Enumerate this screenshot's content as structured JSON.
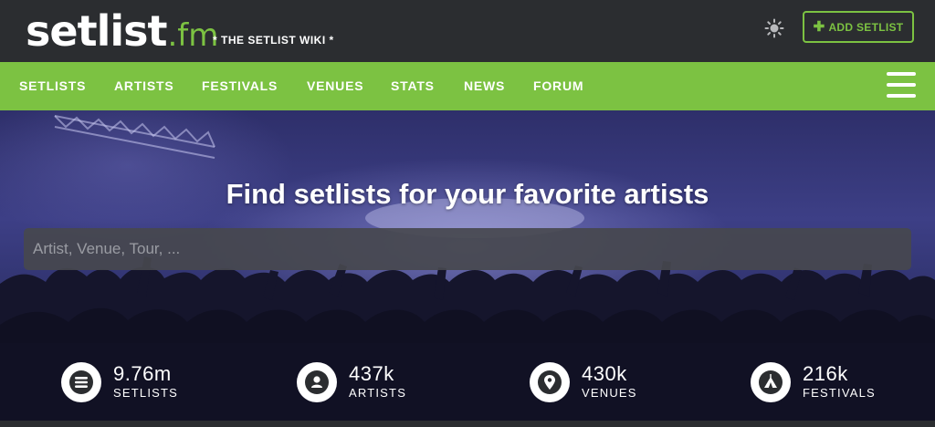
{
  "header": {
    "logo_main": "setlist",
    "logo_tld": ".fm",
    "tagline": "* THE SETLIST WIKI *",
    "add_setlist_label": "ADD SETLIST",
    "theme_icon": "sun-icon",
    "brand_color": "#7cc242"
  },
  "nav": {
    "items": [
      {
        "label": "SETLISTS"
      },
      {
        "label": "ARTISTS"
      },
      {
        "label": "FESTIVALS"
      },
      {
        "label": "VENUES"
      },
      {
        "label": "STATS"
      },
      {
        "label": "NEWS"
      },
      {
        "label": "FORUM"
      }
    ],
    "menu_icon": "hamburger-icon"
  },
  "hero": {
    "title": "Find setlists for your favorite artists",
    "search_placeholder": "Artist, Venue, Tour, ..."
  },
  "stats": [
    {
      "value": "9.76m",
      "label": "SETLISTS",
      "icon": "list-icon"
    },
    {
      "value": "437k",
      "label": "ARTISTS",
      "icon": "person-icon"
    },
    {
      "value": "430k",
      "label": "VENUES",
      "icon": "location-pin-icon"
    },
    {
      "value": "216k",
      "label": "FESTIVALS",
      "icon": "tent-icon"
    }
  ]
}
